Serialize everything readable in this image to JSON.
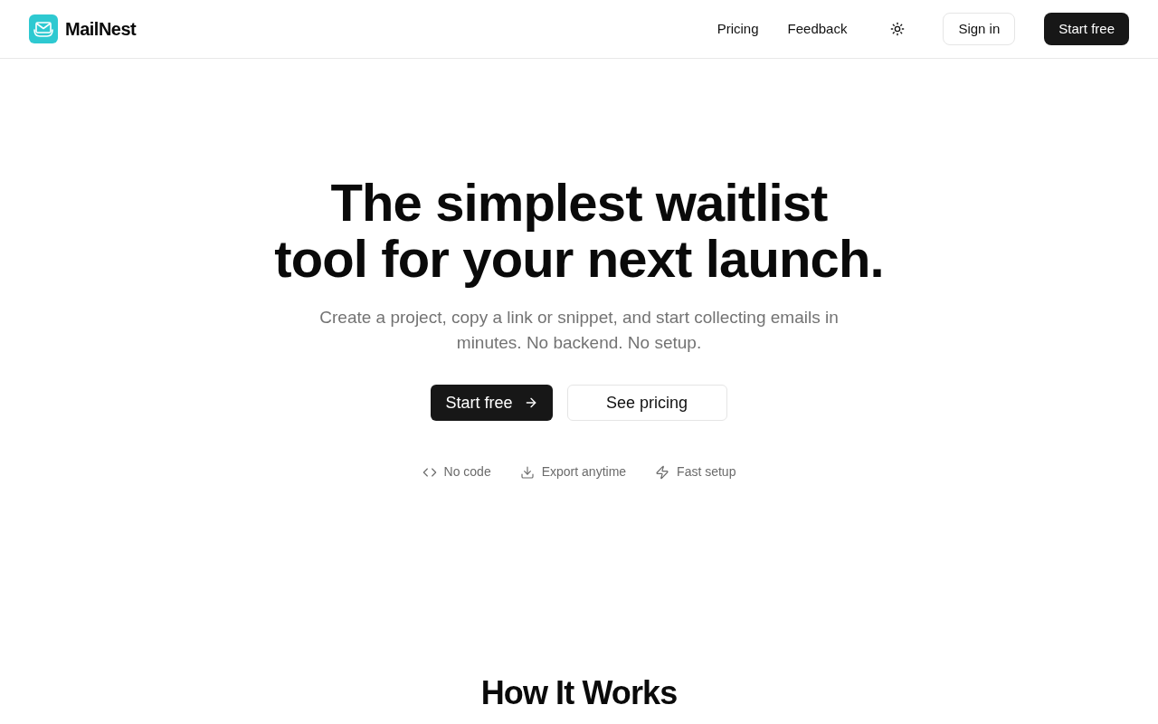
{
  "header": {
    "brand": "MailNest",
    "nav": [
      {
        "label": "Pricing"
      },
      {
        "label": "Feedback"
      }
    ],
    "buttons": [
      {
        "label": "Sign in",
        "kind": "outline"
      },
      {
        "label": "Start free",
        "kind": "solid"
      }
    ]
  },
  "hero": {
    "title_lines": [
      "The simplest waitlist",
      "tool for your next launch."
    ],
    "subtitle": "Create a project, copy a link or snippet, and start collecting emails in minutes. No backend. No setup.",
    "buttons": [
      {
        "label": "Start free",
        "kind": "solid"
      },
      {
        "label": "See pricing",
        "kind": "outline"
      }
    ],
    "features": [
      {
        "label": "No code",
        "kind": "code"
      },
      {
        "label": "Export anytime",
        "kind": "download"
      },
      {
        "label": "Fast setup",
        "kind": "zap"
      }
    ]
  },
  "section": {
    "title": "How It Works"
  }
}
